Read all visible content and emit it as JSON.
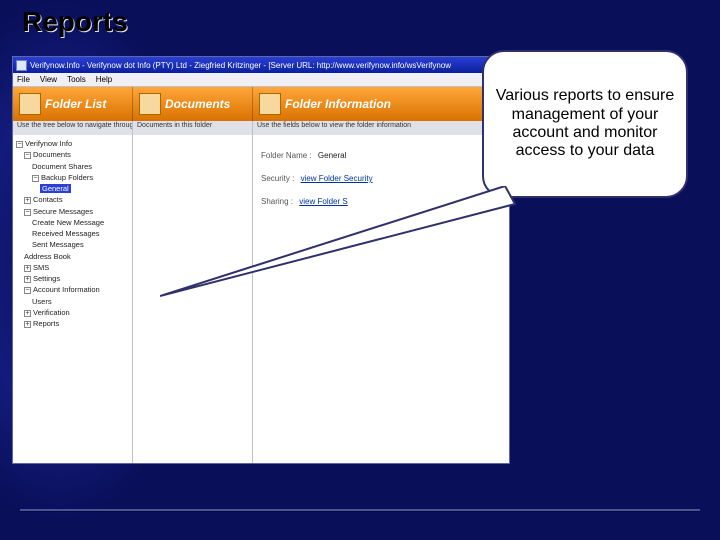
{
  "slide": {
    "title": "Reports",
    "callout_text": "Various reports to ensure management of your account and monitor access to your data"
  },
  "app": {
    "window_title": "Verifynow.Info - Verifynow dot Info (PTY) Ltd - Ziegfried Kritzinger - [Server URL: http://www.verifynow.info/wsVerifynow",
    "menu": {
      "file": "File",
      "view": "View",
      "tools": "Tools",
      "help": "Help"
    },
    "panel_headers": {
      "folder_list": "Folder List",
      "documents": "Documents",
      "folder_information": "Folder Information"
    },
    "sub_headers": {
      "tree_hint": "Use the tree below to navigate through all f",
      "docs_hint": "Documents in this folder",
      "info_hint": "Use the fields below to view the folder information"
    },
    "tree": {
      "root": "Verifynow Info",
      "documents": "Documents",
      "document_shares": "Document Shares",
      "backup_folders": "Backup Folders",
      "general": "General",
      "contacts": "Contacts",
      "secure_messages": "Secure Messages",
      "create_new_message": "Create New Message",
      "received_messages": "Received Messages",
      "sent_messages": "Sent Messages",
      "address_book": "Address Book",
      "sms": "SMS",
      "settings": "Settings",
      "account_information": "Account Information",
      "users": "Users",
      "verification": "Verification",
      "reports": "Reports"
    },
    "folder_info": {
      "folder_name_label": "Folder Name :",
      "folder_name_value": "General",
      "security_label": "Security :",
      "security_link": "view Folder Security",
      "sharing_label": "Sharing :",
      "sharing_link": "view Folder S"
    }
  },
  "colors": {
    "slide_bg": "#0a0f5a",
    "header_gradient_top": "#ffa63a",
    "header_gradient_bottom": "#d97200",
    "titlebar_blue": "#2a3fd4",
    "selection_blue": "#2a3fd4"
  }
}
